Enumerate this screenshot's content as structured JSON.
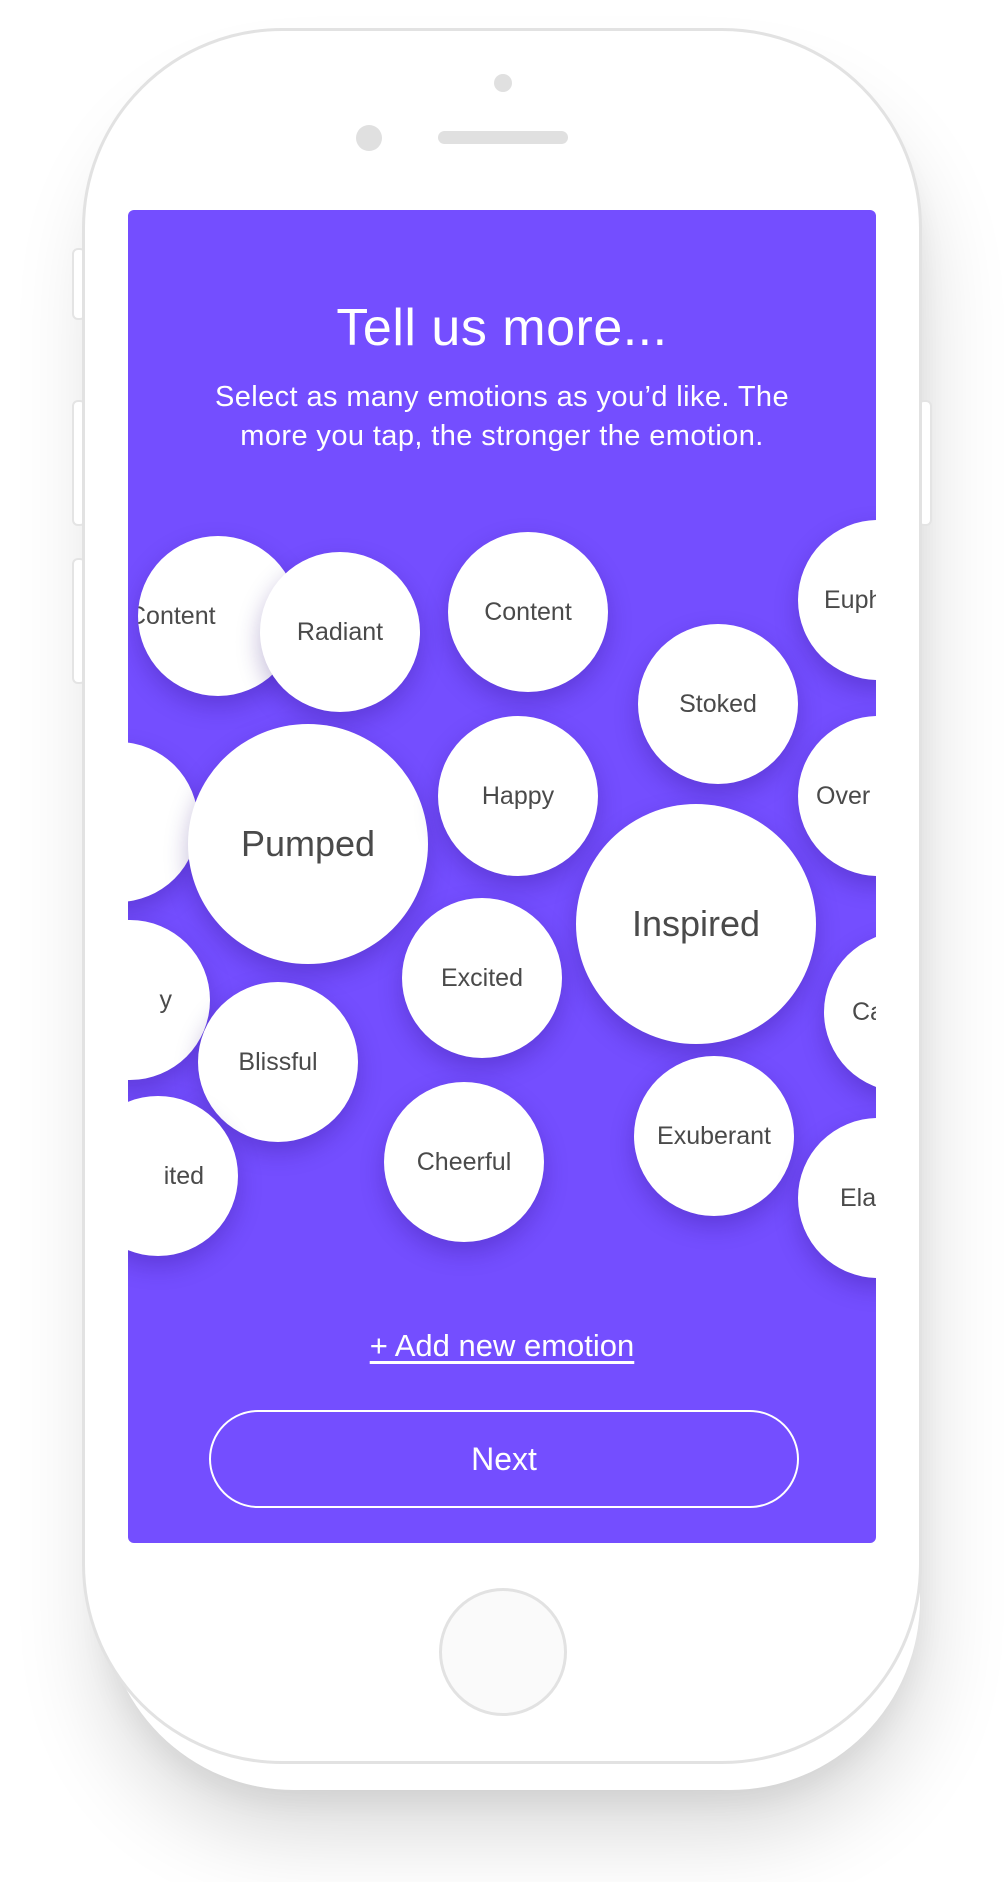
{
  "colors": {
    "screen_background": "#744eff",
    "bubble_background": "#ffffff",
    "bubble_text": "#4a4a4a",
    "device_frame": "#e2e2e2"
  },
  "header": {
    "title": "Tell us more...",
    "subtitle_line1": "Select as many emotions as you’d like. The",
    "subtitle_line2": "more you tap, the stronger the emotion."
  },
  "emotions": [
    {
      "label": "Content"
    },
    {
      "label": "Radiant"
    },
    {
      "label": "Content"
    },
    {
      "label": "Euph"
    },
    {
      "label": "Stoked"
    },
    {
      "label": ""
    },
    {
      "label": "Pumped"
    },
    {
      "label": "Happy"
    },
    {
      "label": "Over"
    },
    {
      "label": "Inspired"
    },
    {
      "label": "y"
    },
    {
      "label": "Excited"
    },
    {
      "label": "Ca"
    },
    {
      "label": "Blissful"
    },
    {
      "label": "Exuberant"
    },
    {
      "label": "ited"
    },
    {
      "label": "Cheerful"
    },
    {
      "label": "Ela"
    }
  ],
  "actions": {
    "add_emotion": "+ Add new emotion",
    "next": "Next"
  }
}
